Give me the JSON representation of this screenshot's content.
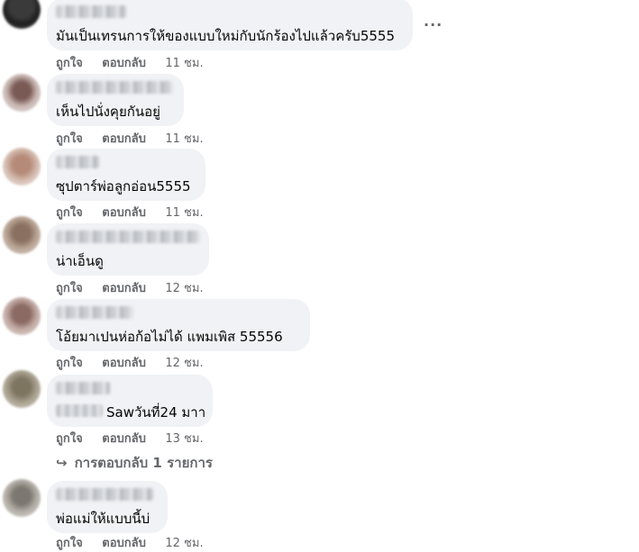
{
  "actions": {
    "like": "ถูกใจ",
    "reply": "ตอบกลับ"
  },
  "comments": [
    {
      "text": "มันเป็นเทรนการให้ของแบบใหม่กับนักร้องไปแล้วครับ5555",
      "time": "11 ชม."
    },
    {
      "text": "เห็นไปนั่งคุยกันอยู่",
      "time": "11 ชม."
    },
    {
      "text": "ซุปตาร์พ่อลูกอ่อน5555",
      "time": "11 ชม."
    },
    {
      "text": "น่าเอ็นดู",
      "time": "12 ชม."
    },
    {
      "text": "โอ้ยมาเปนห่อก้อไม่ได้ แพมเพิส 55556",
      "time": "12 ชม."
    },
    {
      "text": "Sawวันที่24 มาา",
      "time": "13 ชม."
    },
    {
      "text": "พ่อแม่ให้แบบนี้บ่",
      "time": "12 ชม."
    }
  ],
  "more_icon": "···",
  "replies_link": {
    "icon": "↪",
    "label": "การตอบกลับ 1 รายการ"
  }
}
